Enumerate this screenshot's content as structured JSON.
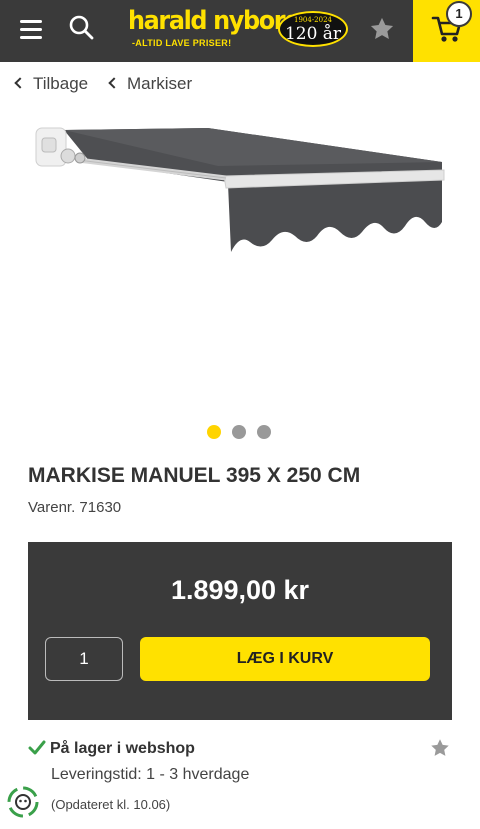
{
  "header": {
    "menu_icon": "hamburger-menu-icon",
    "search_icon": "search-icon",
    "logo": {
      "name": "harald nyborg",
      "tagline": "-ALTID LAVE PRISER!",
      "badge_years": "1904-2024",
      "badge_number": "120 år"
    },
    "favorites_icon": "star-icon",
    "cart_icon": "cart-icon",
    "cart_count": "1",
    "brand_color": "#ffe100",
    "background_color": "#3a3a3a"
  },
  "breadcrumb": {
    "back_label": "Tilbage",
    "category_label": "Markiser"
  },
  "gallery": {
    "image": "awning-product-image",
    "slides": 3,
    "active_slide": 1
  },
  "product": {
    "title": "MARKISE MANUEL 395 X 250 CM",
    "sku": "Varenr. 71630",
    "price": "1.899,00 kr",
    "quantity": "1",
    "add_to_cart_label": "LÆG I KURV"
  },
  "stock": {
    "label": "På lager i webshop",
    "delivery": "Leveringstid: 1 - 3 hverdage",
    "updated": "(Opdateret kl. 10.06)",
    "status_color": "#3aa04a"
  }
}
